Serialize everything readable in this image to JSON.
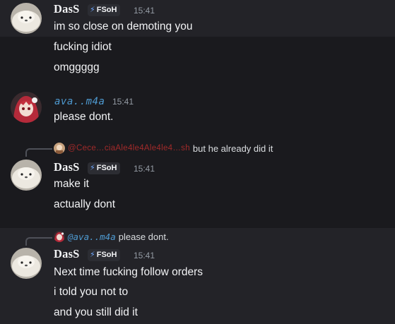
{
  "groups": [
    {
      "username": "DasS",
      "role_tag": "FSoH",
      "time": "15:41",
      "messages": [
        "im so close on demoting you",
        "fucking idiot",
        "omggggg"
      ]
    },
    {
      "username": "ava..m4a",
      "time": "15:41",
      "messages": [
        "please dont."
      ]
    },
    {
      "reply": {
        "mention": "@Cece…ciaAle4le4Ale4le4…sh",
        "text": "but he already did it"
      },
      "username": "DasS",
      "role_tag": "FSoH",
      "time": "15:41",
      "messages": [
        "make it",
        "actually dont"
      ]
    },
    {
      "reply": {
        "mention": "@ava..m4a",
        "text": "please dont."
      },
      "username": "DasS",
      "role_tag": "FSoH",
      "time": "15:41",
      "messages": [
        "Next time fucking follow orders",
        "i told you not to",
        "and you still did it"
      ]
    }
  ],
  "icons": {
    "role_icon": "lightning-bolt-icon",
    "reply_spine": "reply-connector-icon"
  },
  "colors": {
    "background": "#1a1a1e",
    "highlight": "#232328",
    "ava_name": "#4e9ad1",
    "red_mention": "#a12a2a"
  }
}
